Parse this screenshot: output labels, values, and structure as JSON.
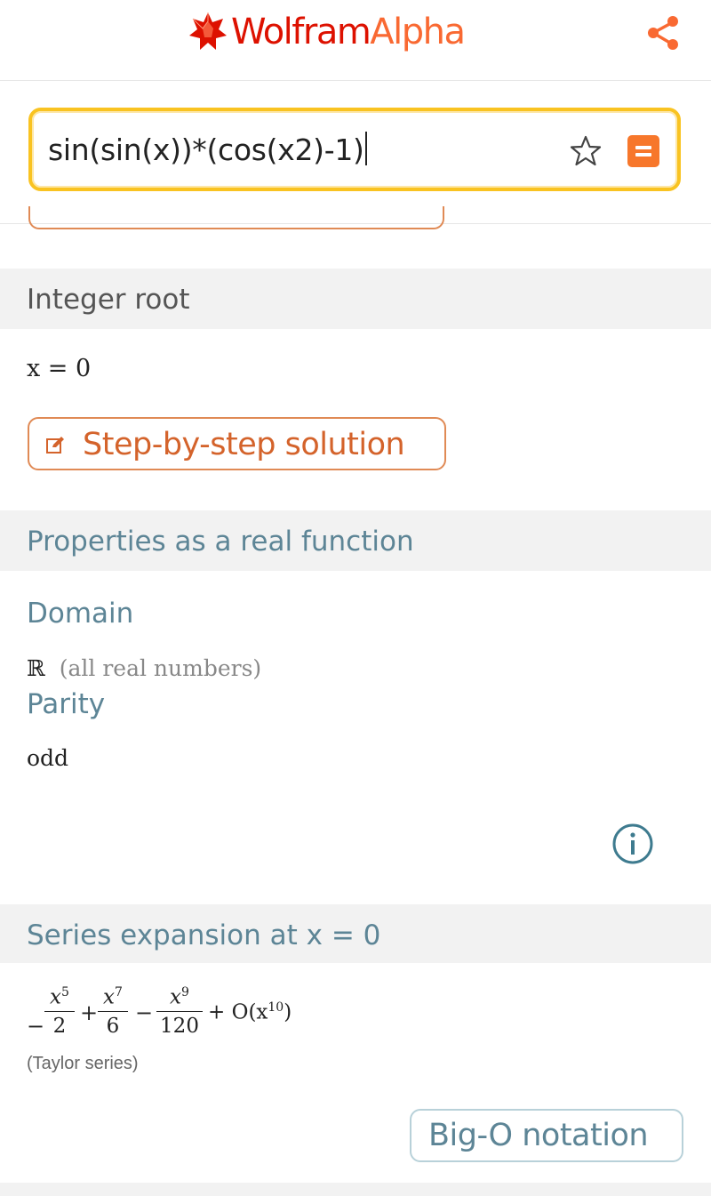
{
  "app": {
    "logo_main": "Wolfram",
    "logo_accent": "Alpha"
  },
  "search": {
    "query": "sin(sin(x))*(cos(x2)-1)"
  },
  "pods": {
    "integer_root": {
      "title": "Integer root",
      "result": "x = 0",
      "button": "Step-by-step solution"
    },
    "properties": {
      "title": "Properties as a real function",
      "domain_label": "Domain",
      "domain_symbol": "ℝ",
      "domain_note": "(all real numbers)",
      "parity_label": "Parity",
      "parity_value": "odd"
    },
    "series": {
      "title": "Series expansion at x = 0",
      "minus1": "−",
      "t1_num": "x",
      "t1_exp": "5",
      "t1_den": "2",
      "plus1": "+",
      "t2_num": "x",
      "t2_exp": "7",
      "t2_den": "6",
      "minus2": "−",
      "t3_num": "x",
      "t3_exp": "9",
      "t3_den": "120",
      "tail_pre": "+ O(x",
      "tail_exp": "10",
      "tail_post": ")",
      "note": "(Taylor series)",
      "button": "Big-O notation"
    }
  },
  "colors": {
    "brand_red": "#dd1100",
    "brand_orange": "#f96932",
    "teal": "#5d8596",
    "search_border": "#f9c321"
  },
  "icons": [
    "wolfram-spikey-icon",
    "share-icon",
    "star-icon",
    "equals-icon",
    "edit-icon",
    "info-icon"
  ]
}
